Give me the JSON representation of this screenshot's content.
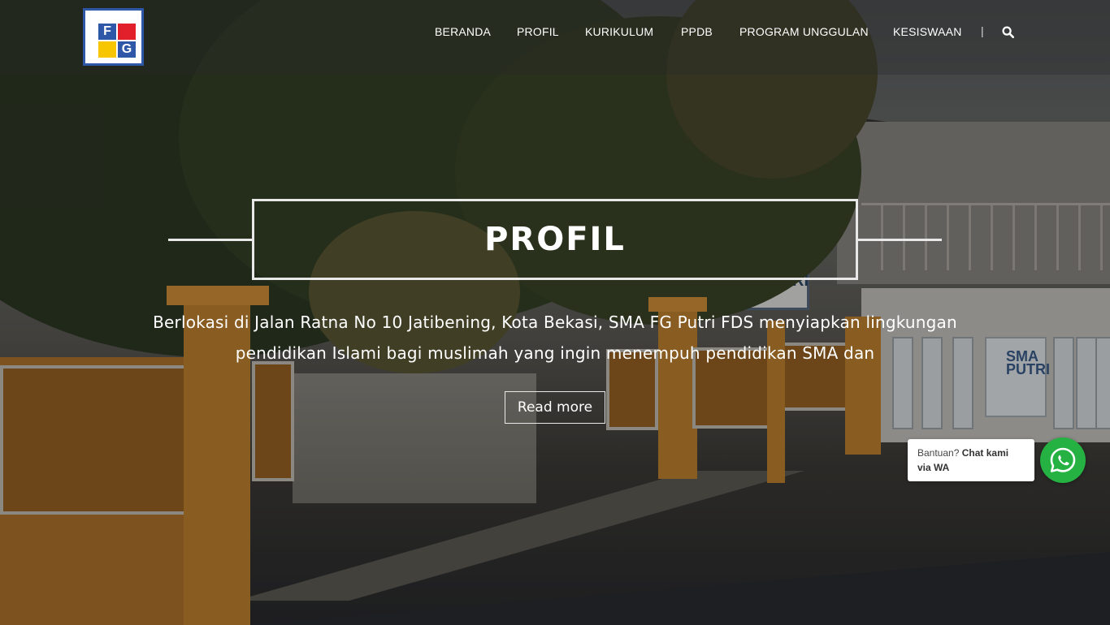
{
  "header": {
    "logo_letters": [
      "F",
      "G"
    ],
    "nav": [
      {
        "label": "BERANDA"
      },
      {
        "label": "PROFIL"
      },
      {
        "label": "KURIKULUM"
      },
      {
        "label": "PPDB"
      },
      {
        "label": "PROGRAM UNGGULAN"
      },
      {
        "label": "KESISWAAN"
      }
    ],
    "separator": "|",
    "search_icon": "search-icon"
  },
  "hero": {
    "title": "PROFIL",
    "description_line1": "Berlokasi di Jalan Ratna No 10 Jatibening, Kota Bekasi, SMA FG Putri FDS menyiapkan lingkungan",
    "description_line2": "pendidikan Islami bagi muslimah yang ingin menempuh pendidikan SMA dan",
    "read_more": "Read more"
  },
  "chat_widget": {
    "prefix": "Bantuan?",
    "bold_text": "Chat kami via WA",
    "icon": "whatsapp-icon",
    "color": "#25b243"
  },
  "colors": {
    "logo_blue": "#2e58a7",
    "logo_red": "#e2202b",
    "logo_yellow": "#f7c600"
  }
}
